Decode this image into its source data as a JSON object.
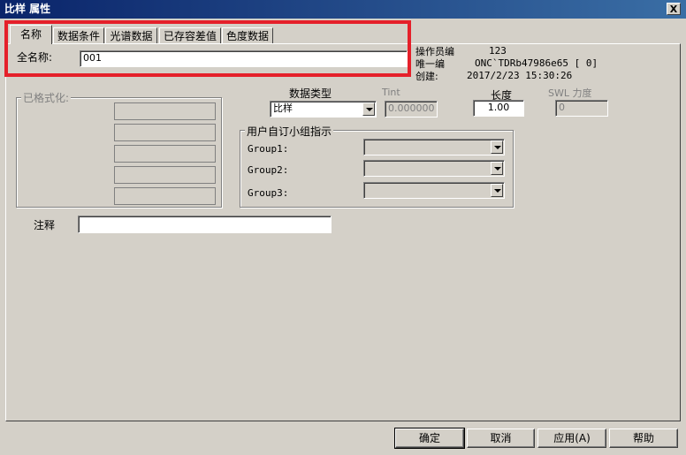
{
  "window": {
    "title": "比样 属性",
    "close_label": "X"
  },
  "tabs": [
    {
      "label": "名称"
    },
    {
      "label": "数据条件"
    },
    {
      "label": "光谱数据"
    },
    {
      "label": "已存容差值"
    },
    {
      "label": "色度数据"
    }
  ],
  "name_section": {
    "full_name_label": "全名称:",
    "full_name_value": "001"
  },
  "info": {
    "operator_label": "操作员编",
    "operator_value": "123",
    "unique_label": "唯一编",
    "unique_value": "ONC`TDRb47986e65 [ 0]",
    "created_label": "创建:",
    "created_value": "2017/2/23 15:30:26"
  },
  "format_group": {
    "title": "已格式化:"
  },
  "data_type": {
    "label": "数据类型",
    "value": "比样"
  },
  "tint": {
    "label": "Tint",
    "value": "0.000000"
  },
  "length": {
    "label": "长度",
    "value": "1.00"
  },
  "swl": {
    "label": "SWL 力度",
    "value": "0"
  },
  "user_group": {
    "title": "用户自订小组指示",
    "group1_label": "Group1:",
    "group2_label": "Group2:",
    "group3_label": "Group3:"
  },
  "comment": {
    "label": "注释",
    "value": ""
  },
  "buttons": {
    "ok": "确定",
    "cancel": "取消",
    "apply": "应用(A)",
    "help": "帮助"
  },
  "colors": {
    "highlight": "#e5202a",
    "title_bar": "#0a246a"
  }
}
